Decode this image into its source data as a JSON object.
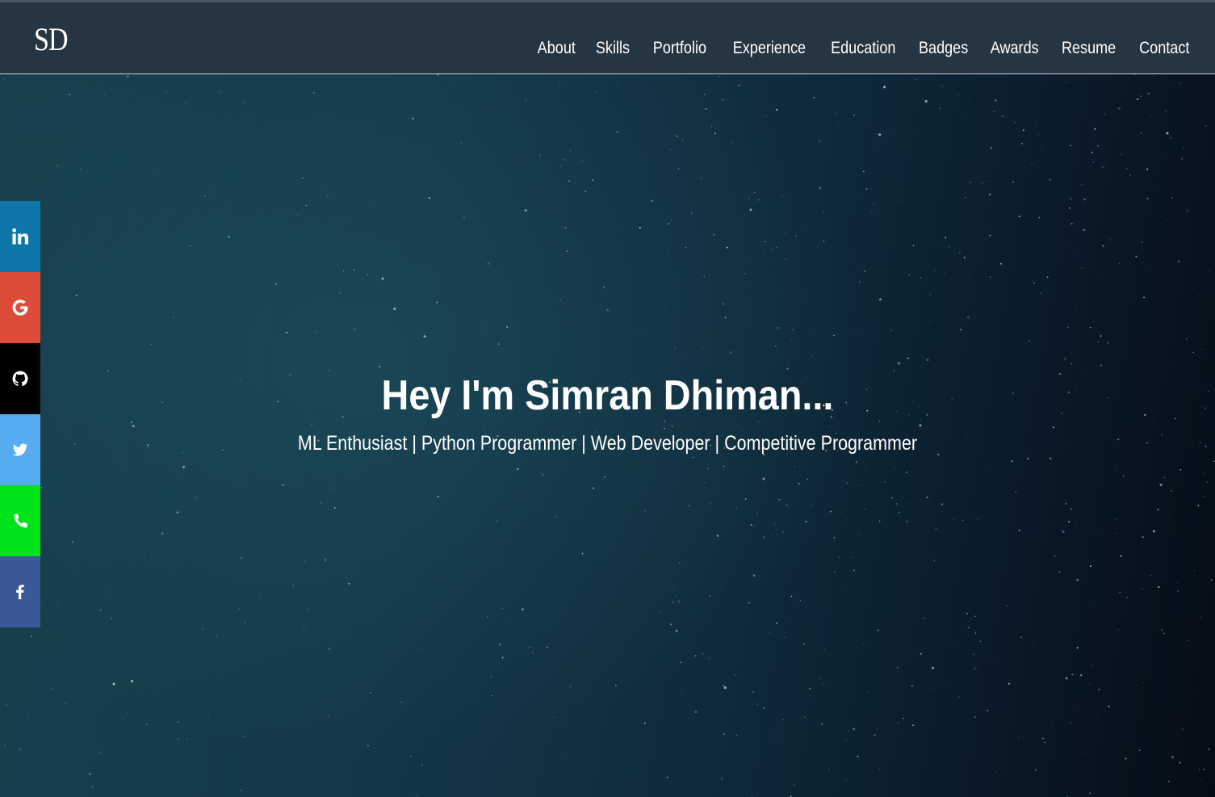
{
  "brand": {
    "logo_text": "SD"
  },
  "nav": {
    "items": [
      {
        "label": "About"
      },
      {
        "label": "Skills"
      },
      {
        "label": "Portfolio"
      },
      {
        "label": "Experience"
      },
      {
        "label": "Education"
      },
      {
        "label": "Badges"
      },
      {
        "label": "Awards"
      },
      {
        "label": "Resume"
      },
      {
        "label": "Contact"
      }
    ]
  },
  "hero": {
    "headline": "Hey I'm Simran Dhiman...",
    "tagline": "ML Enthusiast | Python Programmer | Web Developer | Competitive Programmer"
  },
  "social": [
    {
      "icon": "linkedin-icon",
      "color": "#0e76a8"
    },
    {
      "icon": "google-icon",
      "color": "#dd4b39"
    },
    {
      "icon": "github-icon",
      "color": "#000000"
    },
    {
      "icon": "twitter-icon",
      "color": "#55acee"
    },
    {
      "icon": "phone-icon",
      "color": "#00e31a"
    },
    {
      "icon": "facebook-icon",
      "color": "#3b5998"
    }
  ],
  "colors": {
    "navbar_bg": "#253542",
    "hero_bg": "#17414d",
    "text": "#ffffff"
  }
}
